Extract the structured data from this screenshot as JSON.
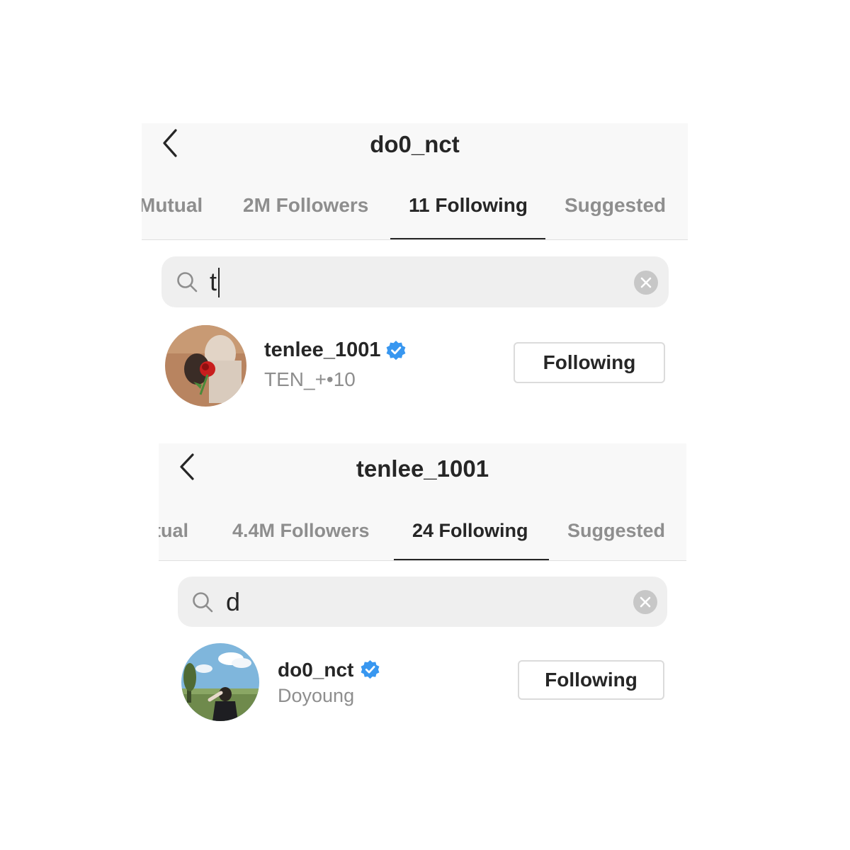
{
  "panels": [
    {
      "title": "do0_nct",
      "tabs": [
        {
          "label": "Mutual"
        },
        {
          "label": "2M Followers"
        },
        {
          "label": "11 Following"
        },
        {
          "label": "Suggested"
        }
      ],
      "search": {
        "value": "t"
      },
      "result": {
        "username": "tenlee_1001",
        "full_name": "TEN_+•10",
        "button_label": "Following",
        "verified": true
      }
    },
    {
      "title": "tenlee_1001",
      "tabs": [
        {
          "label": "Mutual"
        },
        {
          "label": "4.4M Followers"
        },
        {
          "label": "24 Following"
        },
        {
          "label": "Suggested"
        }
      ],
      "search": {
        "value": "d"
      },
      "result": {
        "username": "do0_nct",
        "full_name": "Doyoung",
        "button_label": "Following",
        "verified": true
      }
    }
  ],
  "colors": {
    "verified_badge": "#3897f0",
    "header_bg": "#f8f8f8",
    "search_bg": "#efefef",
    "inactive_tab": "#8e8e8e"
  }
}
